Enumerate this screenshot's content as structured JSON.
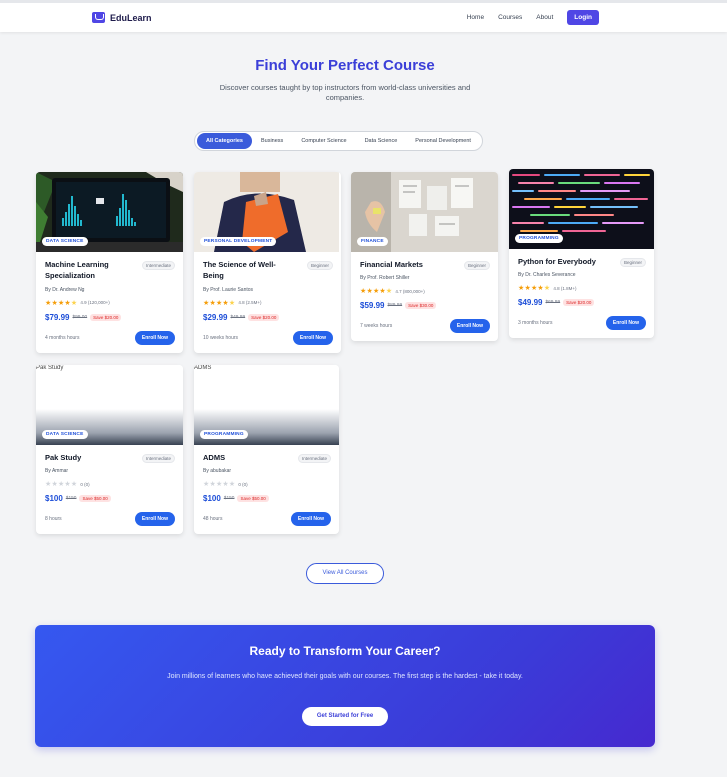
{
  "header": {
    "brand": "EduLearn",
    "nav": [
      "Home",
      "Courses",
      "About"
    ],
    "login": "Login"
  },
  "hero": {
    "title": "Find Your Perfect Course",
    "subtitle": "Discover courses taught by top instructors from world-class universities and companies."
  },
  "filters": [
    "All Categories",
    "Business",
    "Computer Science",
    "Data Science",
    "Personal Development"
  ],
  "courses": [
    {
      "title": "Machine Learning Specialization",
      "badge": "DATA SCIENCE",
      "level": "Intermediate",
      "author": "By Dr. Andrew Ng",
      "rating_text": "4.9 (120,000+)",
      "rating": 4.9,
      "price": "$79.99",
      "original": "$99.00",
      "save": "Save $20.00",
      "duration": "4 months hours",
      "enroll": "Enroll Now",
      "image": "laptop-charts-image"
    },
    {
      "title": "The Science of Well-Being",
      "badge": "PERSONAL DEVELOPMENT",
      "level": "Beginner",
      "author": "By Prof. Laurie Santos",
      "rating_text": "4.8 (2.5M+)",
      "rating": 4.8,
      "price": "$29.99",
      "original": "$49.99",
      "save": "Save $20.00",
      "duration": "10 weeks hours",
      "enroll": "Enroll Now",
      "image": "person-orange-image"
    },
    {
      "title": "Financial Markets",
      "badge": "FINANCE",
      "level": "Beginner",
      "author": "By Prof. Robert Shiller",
      "rating_text": "4.7 (800,000+)",
      "rating": 4.7,
      "price": "$59.99",
      "original": "$89.99",
      "save": "Save $30.00",
      "duration": "7 weeks hours",
      "enroll": "Enroll Now",
      "image": "papers-wall-image"
    },
    {
      "title": "Python for Everybody",
      "badge": "PROGRAMMING",
      "level": "Beginner",
      "author": "By Dr. Charles Severance",
      "rating_text": "4.8 (1.8M+)",
      "rating": 4.8,
      "price": "$49.99",
      "original": "$69.99",
      "save": "Save $20.00",
      "duration": "3 months hours",
      "enroll": "Enroll Now",
      "image": "code-screen-image"
    },
    {
      "title": "Pak Study",
      "badge": "DATA SCIENCE",
      "level": "Intermediate",
      "author": "By Ammar",
      "rating_text": "0 (0)",
      "rating": 0,
      "price": "$100",
      "original": "$150",
      "save": "Save $50.00",
      "duration": "8 hours",
      "enroll": "Enroll Now",
      "alt": "Pak Study"
    },
    {
      "title": "ADMS",
      "badge": "PROGRAMMING",
      "level": "Intermediate",
      "author": "By abubakar",
      "rating_text": "0 (0)",
      "rating": 0,
      "price": "$100",
      "original": "$150",
      "save": "Save $50.00",
      "duration": "48 hours",
      "enroll": "Enroll Now",
      "alt": "ADMS"
    }
  ],
  "view_all": "View All Courses",
  "cta": {
    "title": "Ready to Transform Your Career?",
    "text": "Join millions of learners who have achieved their goals with our courses. The first step is the hardest - take it today.",
    "button": "Get Started for Free"
  }
}
